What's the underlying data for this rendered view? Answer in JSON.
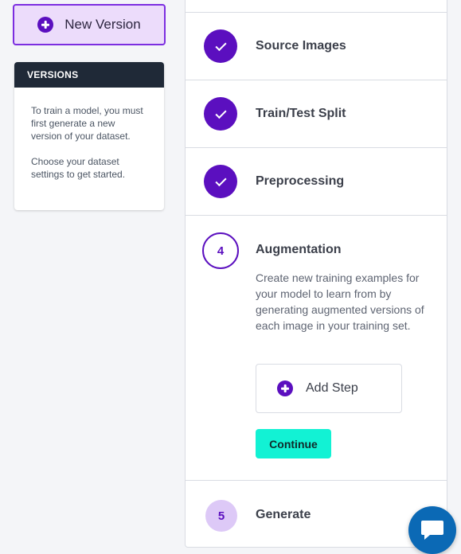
{
  "sidebar": {
    "new_version_label": "New Version",
    "versions_title": "VERSIONS",
    "versions_text_1": "To train a model, you must first generate a new version of your dataset.",
    "versions_text_2": "Choose your dataset settings to get started."
  },
  "steps": [
    {
      "label": "Source Images",
      "status": "complete"
    },
    {
      "label": "Train/Test Split",
      "status": "complete"
    },
    {
      "label": "Preprocessing",
      "status": "complete"
    },
    {
      "number": "4",
      "label": "Augmentation",
      "status": "active",
      "description": "Create new training examples for your model to learn from by generating augmented versions of each image in your training set.",
      "add_step_label": "Add Step",
      "continue_label": "Continue"
    },
    {
      "number": "5",
      "label": "Generate",
      "status": "pending"
    }
  ],
  "chat": {
    "icon": "chat-bubble-icon"
  },
  "colors": {
    "accent": "#5b0fbf",
    "accent_light": "#ddc9f7",
    "continue": "#12f2d4",
    "header_dark": "#1f2937",
    "chat": "#0b69b5"
  }
}
